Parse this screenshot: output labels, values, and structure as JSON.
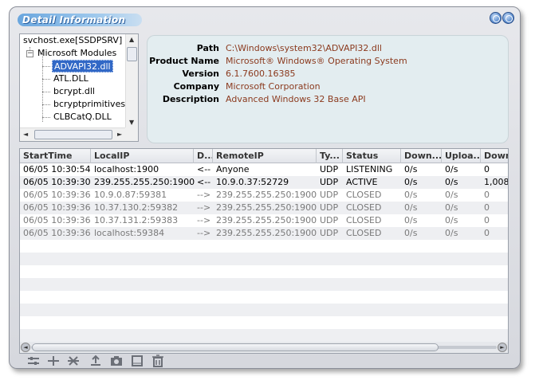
{
  "window": {
    "title": "Detail Information"
  },
  "tree": {
    "items": [
      {
        "label": "svchost.exe[SSDPSRV]"
      },
      {
        "label": "Microsoft Modules"
      },
      {
        "label": "ADVAPI32.dll"
      },
      {
        "label": "ATL.DLL"
      },
      {
        "label": "bcrypt.dll"
      },
      {
        "label": "bcryptprimitives.dll"
      },
      {
        "label": "CLBCatQ.DLL"
      }
    ],
    "selected": "ADVAPI32.dll"
  },
  "details": {
    "path_label": "Path",
    "path_value": "C:\\Windows\\system32\\ADVAPI32.dll",
    "product_label": "Product Name",
    "product_value": "Microsoft® Windows® Operating System",
    "version_label": "Version",
    "version_value": "6.1.7600.16385",
    "company_label": "Company",
    "company_value": "Microsoft Corporation",
    "description_label": "Description",
    "description_value": "Advanced Windows 32 Base API"
  },
  "grid": {
    "columns": [
      "StartTime",
      "LocalIP",
      "D...",
      "RemoteIP",
      "Ty...",
      "Status",
      "Down...",
      "Uploa...",
      "Down"
    ],
    "rows": [
      [
        "06/05 10:30:54",
        "localhost:1900",
        "<--",
        "Anyone",
        "UDP",
        "LISTENING",
        "0/s",
        "0/s",
        "0"
      ],
      [
        "06/05 10:39:30",
        "239.255.255.250:1900",
        "<--",
        "10.9.0.37:52729",
        "UDP",
        "ACTIVE",
        "0/s",
        "0/s",
        "1,008"
      ],
      [
        "06/05 10:39:36",
        "10.9.0.87:59381",
        "-->",
        "239.255.255.250:1900",
        "UDP",
        "CLOSED",
        "0/s",
        "0/s",
        "0"
      ],
      [
        "06/05 10:39:36",
        "10.37.130.2:59382",
        "-->",
        "239.255.255.250:1900",
        "UDP",
        "CLOSED",
        "0/s",
        "0/s",
        "0"
      ],
      [
        "06/05 10:39:36",
        "10.37.131.2:59383",
        "-->",
        "239.255.255.250:1900",
        "UDP",
        "CLOSED",
        "0/s",
        "0/s",
        "0"
      ],
      [
        "06/05 10:39:36",
        "localhost:59384",
        "-->",
        "239.255.255.250:1900",
        "UDP",
        "CLOSED",
        "0/s",
        "0/s",
        "0"
      ]
    ]
  },
  "toolbar": {
    "icons": [
      "filter-icon",
      "split-icon",
      "cross-icon",
      "upload-icon",
      "camera-icon",
      "book-icon",
      "trash-icon"
    ]
  }
}
